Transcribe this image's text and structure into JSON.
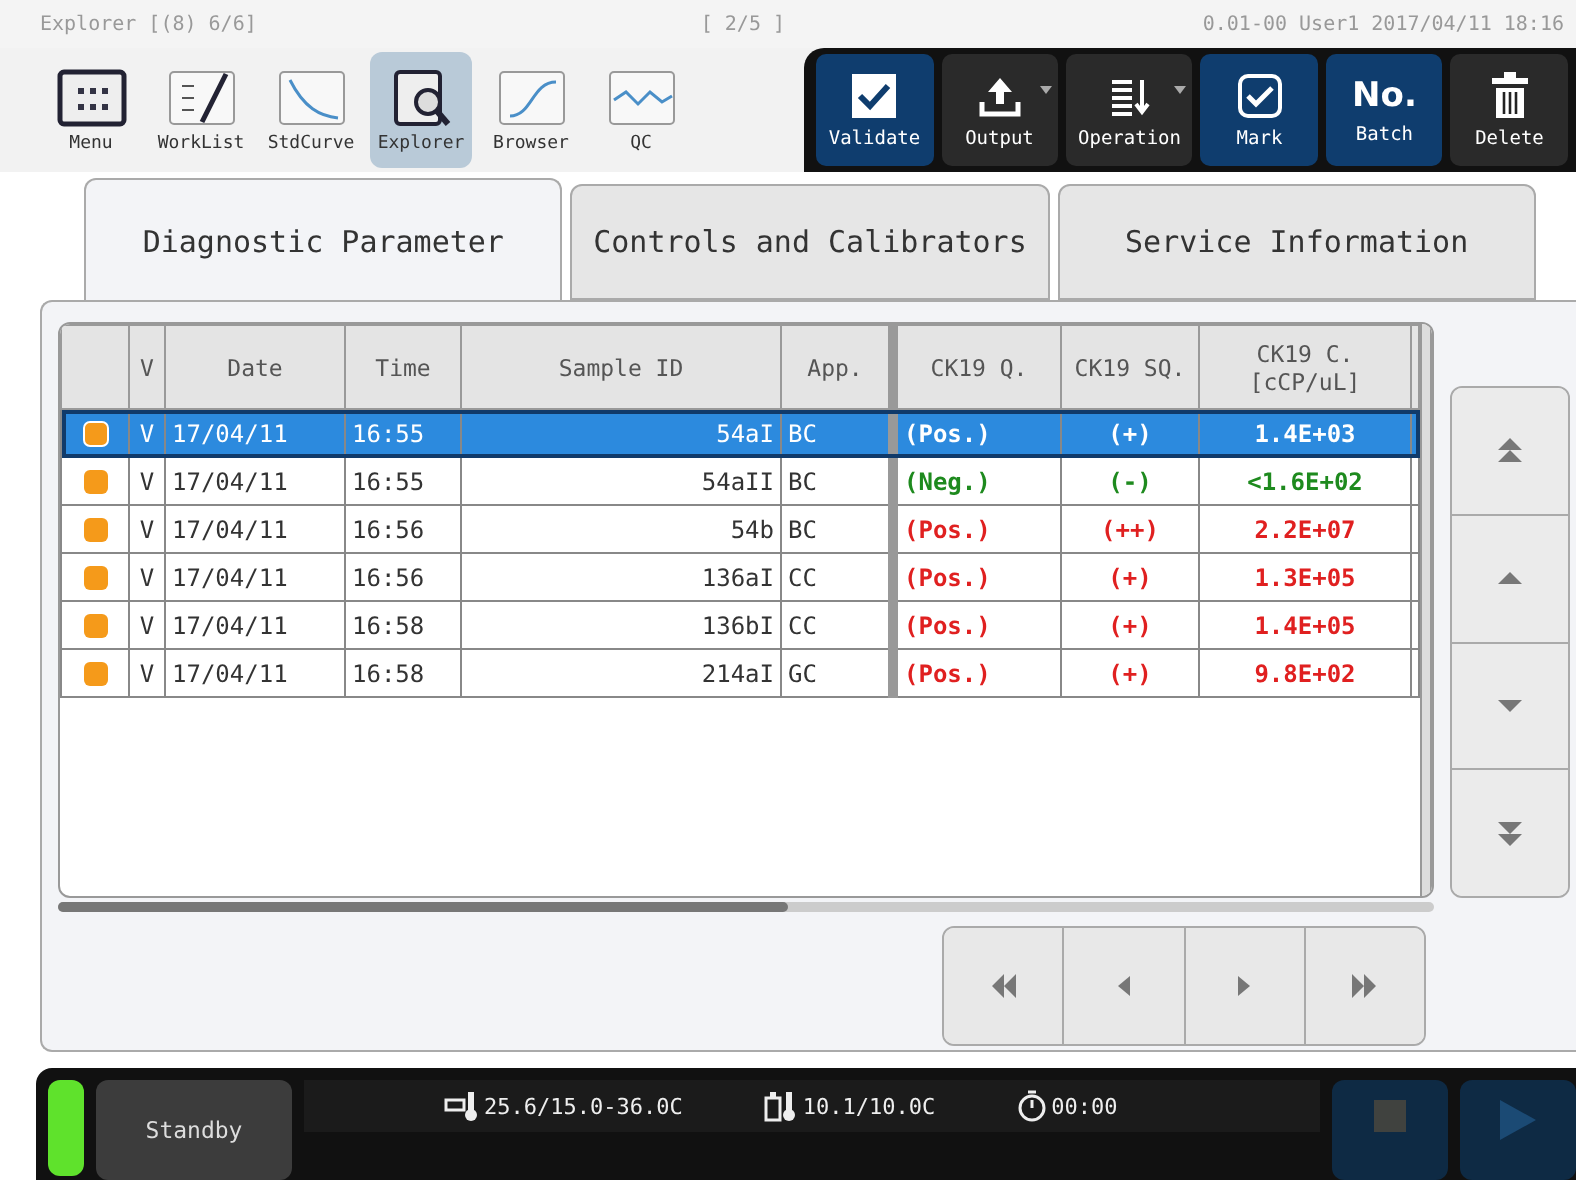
{
  "header": {
    "title": "Explorer [(8) 6/6]",
    "page": "[ 2/5 ]",
    "info": "0.01-00 User1 2017/04/11 18:16"
  },
  "tools": [
    {
      "label": "Menu",
      "selected": false
    },
    {
      "label": "WorkList",
      "selected": false
    },
    {
      "label": "StdCurve",
      "selected": false
    },
    {
      "label": "Explorer",
      "selected": true
    },
    {
      "label": "Browser",
      "selected": false
    },
    {
      "label": "QC",
      "selected": false
    }
  ],
  "actions": [
    {
      "label": "Validate",
      "highlight": true,
      "dropdown": false
    },
    {
      "label": "Output",
      "highlight": false,
      "dropdown": true
    },
    {
      "label": "Operation",
      "highlight": false,
      "dropdown": true
    },
    {
      "label": "Mark",
      "highlight": true,
      "dropdown": false
    },
    {
      "label": "Batch",
      "symbol": "No.",
      "highlight": true,
      "dropdown": false
    },
    {
      "label": "Delete",
      "highlight": false,
      "dropdown": false
    }
  ],
  "tabs": [
    {
      "label": "Diagnostic Parameter",
      "selected": true
    },
    {
      "label": "Controls and Calibrators",
      "selected": false
    },
    {
      "label": "Service Information",
      "selected": false
    }
  ],
  "table": {
    "columns": [
      "V",
      "Date",
      "Time",
      "Sample ID",
      "App.",
      "CK19 Q.",
      "CK19 SQ.",
      "CK19 C. [cCP/uL]"
    ],
    "rows": [
      {
        "selected": true,
        "cells": [
          "V",
          "17/04/11",
          "16:55",
          "54aI",
          "BC",
          "(Pos.)",
          "(+)",
          "1.4E+03"
        ],
        "kind": "positive"
      },
      {
        "selected": false,
        "cells": [
          "V",
          "17/04/11",
          "16:55",
          "54aII",
          "BC",
          "(Neg.)",
          "(-)",
          "<1.6E+02"
        ],
        "kind": "negative"
      },
      {
        "selected": false,
        "cells": [
          "V",
          "17/04/11",
          "16:56",
          "54b",
          "BC",
          "(Pos.)",
          "(++)",
          "2.2E+07"
        ],
        "kind": "positive"
      },
      {
        "selected": false,
        "cells": [
          "V",
          "17/04/11",
          "16:56",
          "136aI",
          "CC",
          "(Pos.)",
          "(+)",
          "1.3E+05"
        ],
        "kind": "positive"
      },
      {
        "selected": false,
        "cells": [
          "V",
          "17/04/11",
          "16:58",
          "136bI",
          "CC",
          "(Pos.)",
          "(+)",
          "1.4E+05"
        ],
        "kind": "positive"
      },
      {
        "selected": false,
        "cells": [
          "V",
          "17/04/11",
          "16:58",
          "214aI",
          "GC",
          "(Pos.)",
          "(+)",
          "9.8E+02"
        ],
        "kind": "positive"
      }
    ]
  },
  "status": {
    "state": "Standby",
    "readings": [
      "25.6/15.0-36.0C",
      "10.1/10.0C",
      "00:00"
    ],
    "controls": [
      {
        "disabled": true
      },
      {
        "disabled": true
      }
    ]
  }
}
